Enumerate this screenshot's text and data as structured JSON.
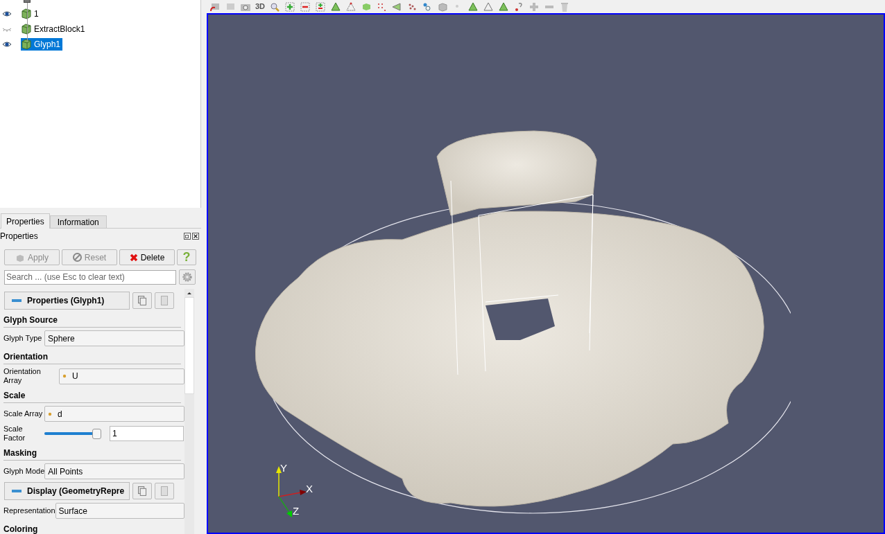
{
  "pipeline": {
    "items": [
      {
        "label": "1",
        "visible": true,
        "selected": false
      },
      {
        "label": "ExtractBlock1",
        "visible": false,
        "selected": false
      },
      {
        "label": "Glyph1",
        "visible": true,
        "selected": true
      }
    ]
  },
  "tabs": [
    {
      "label": "Properties",
      "selected": true
    },
    {
      "label": "Information",
      "selected": false
    }
  ],
  "panel_title": "Properties",
  "buttons": [
    {
      "kind": "apply",
      "label": "Apply",
      "disabled": true
    },
    {
      "kind": "reset",
      "label": "Reset",
      "disabled": true
    },
    {
      "kind": "delete",
      "label": "Delete",
      "disabled": false
    },
    {
      "kind": "help",
      "label": "?",
      "disabled": false
    }
  ],
  "search": {
    "placeholder": "Search ... (use Esc to clear text)"
  },
  "properties": [
    {
      "kind": "group_header",
      "label": "Properties (Glyph1)"
    },
    {
      "kind": "heading",
      "label": "Glyph Source"
    },
    {
      "kind": "combo",
      "label": "Glyph Type",
      "value": "Sphere"
    },
    {
      "kind": "heading",
      "label": "Orientation"
    },
    {
      "kind": "array",
      "label": "Orientation Array",
      "value": "U"
    },
    {
      "kind": "heading",
      "label": "Scale"
    },
    {
      "kind": "array",
      "label": "Scale Array",
      "value": "d"
    },
    {
      "kind": "slider",
      "label": "Scale Factor",
      "level": 1,
      "value": "1"
    },
    {
      "kind": "heading",
      "label": "Masking"
    },
    {
      "kind": "combo",
      "label": "Glyph Mode",
      "value": "All Points"
    },
    {
      "kind": "group_header",
      "label": "Display (GeometryRepre"
    },
    {
      "kind": "combo",
      "label": "Representation",
      "value": "Surface"
    },
    {
      "kind": "heading",
      "label": "Coloring"
    }
  ],
  "toolbar": {
    "mode_label": "3D"
  },
  "view": {
    "axes": [
      "Y",
      "X",
      "Z"
    ]
  }
}
